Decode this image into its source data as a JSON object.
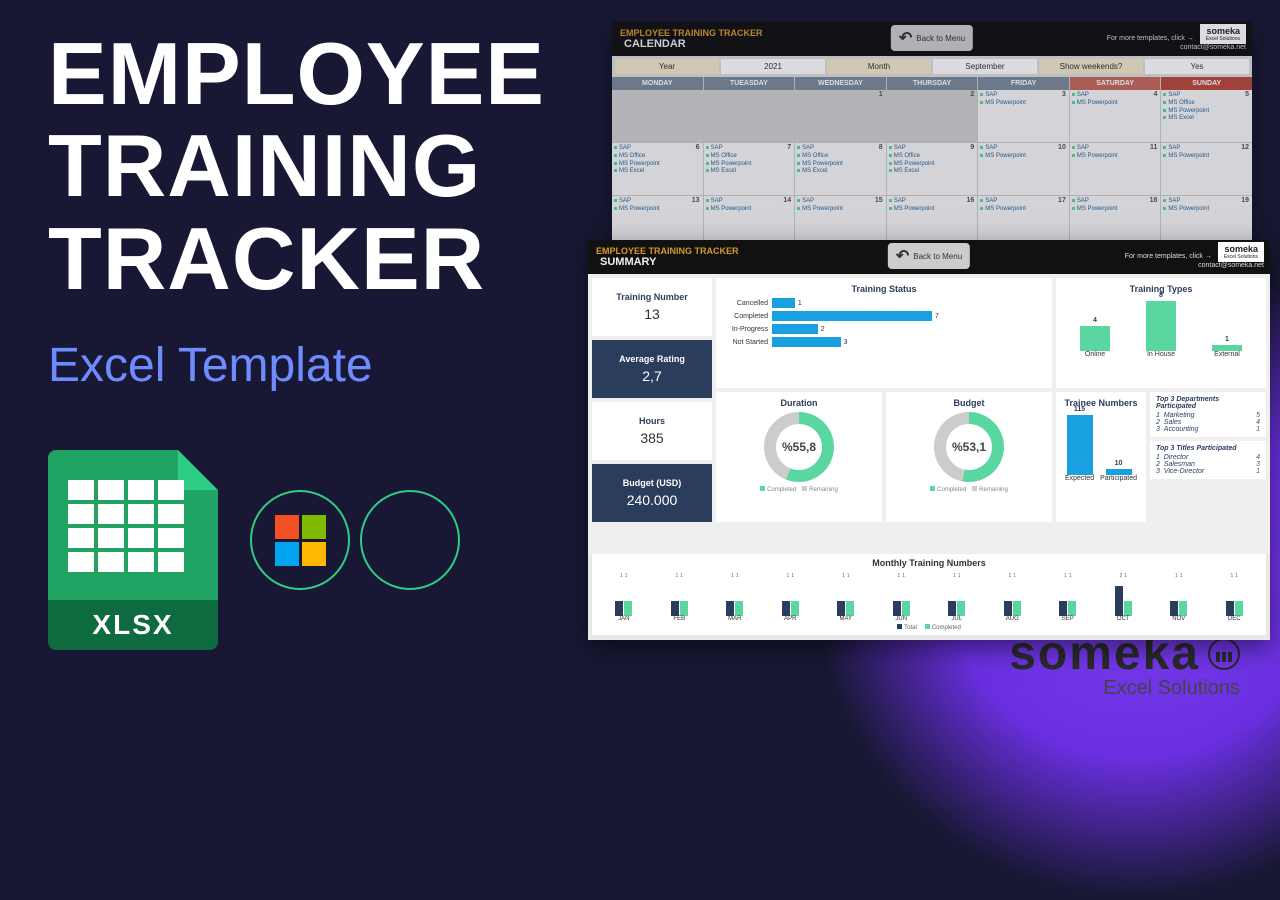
{
  "hero": {
    "line1": "EMPLOYEE",
    "line2": "TRAINING",
    "line3": "TRACKER",
    "subtitle": "Excel Template",
    "xlsx": "XLSX"
  },
  "brand": {
    "name": "someka",
    "sub": "Excel Solutions"
  },
  "header": {
    "product": "EMPLOYEE TRAINING TRACKER",
    "back": "Back to Menu",
    "more": "For more templates, click →",
    "contact": "contact@someka.net",
    "tag": "someka",
    "tag_sub": "Excel Solutions"
  },
  "calendar": {
    "section": "CALENDAR",
    "year_lbl": "Year",
    "year": "2021",
    "month_lbl": "Month",
    "month": "September",
    "wknd_lbl": "Show weekends?",
    "wknd": "Yes",
    "dow": [
      "MONDAY",
      "TUEASDAY",
      "WEDNESDAY",
      "THURSDAY",
      "FRIDAY",
      "SATURDAY",
      "SUNDAY"
    ],
    "cells": [
      {
        "n": "",
        "grey": true
      },
      {
        "n": "",
        "grey": true
      },
      {
        "n": "1",
        "grey": true
      },
      {
        "n": "2",
        "grey": true
      },
      {
        "n": "3",
        "items": [
          "SAP",
          "MS Powerpoint"
        ]
      },
      {
        "n": "4",
        "items": [
          "SAP",
          "MS Powerpoint"
        ]
      },
      {
        "n": "5",
        "items": [
          "SAP",
          "MS Office",
          "MS Powerpoint",
          "MS Excel"
        ]
      },
      {
        "n": "6",
        "items": [
          "SAP",
          "MS Office",
          "MS Powerpoint",
          "MS Excel"
        ]
      },
      {
        "n": "7",
        "items": [
          "SAP",
          "MS Office",
          "MS Powerpoint",
          "MS Excel"
        ]
      },
      {
        "n": "8",
        "items": [
          "SAP",
          "MS Office",
          "MS Powerpoint",
          "MS Excel"
        ]
      },
      {
        "n": "9",
        "items": [
          "SAP",
          "MS Office",
          "MS Powerpoint",
          "MS Excel"
        ]
      },
      {
        "n": "10",
        "items": [
          "SAP",
          "MS Powerpoint"
        ]
      },
      {
        "n": "11",
        "items": [
          "SAP",
          "MS Powerpoint"
        ]
      },
      {
        "n": "12",
        "items": [
          "SAP",
          "MS Powerpoint"
        ]
      },
      {
        "n": "13",
        "items": [
          "SAP",
          "MS Powerpoint"
        ]
      },
      {
        "n": "14",
        "items": [
          "SAP",
          "MS Powerpoint"
        ]
      },
      {
        "n": "15",
        "items": [
          "SAP",
          "MS Powerpoint"
        ]
      },
      {
        "n": "16",
        "items": [
          "SAP",
          "MS Powerpoint"
        ]
      },
      {
        "n": "17",
        "items": [
          "SAP",
          "MS Powerpoint"
        ]
      },
      {
        "n": "18",
        "items": [
          "SAP",
          "MS Powerpoint"
        ]
      },
      {
        "n": "19",
        "items": [
          "SAP",
          "MS Powerpoint"
        ]
      }
    ]
  },
  "summary": {
    "section": "SUMMARY",
    "kpi": {
      "tn_lbl": "Training Number",
      "tn": "13",
      "ar_lbl": "Average Rating",
      "ar": "2,7",
      "hr_lbl": "Hours",
      "hr": "385",
      "bd_lbl": "Budget (USD)",
      "bd": "240.000"
    },
    "status": {
      "title": "Training Status",
      "rows": [
        {
          "lbl": "Cancelled",
          "v": 1
        },
        {
          "lbl": "Completed",
          "v": 7
        },
        {
          "lbl": "In-Progress",
          "v": 2
        },
        {
          "lbl": "Not Started",
          "v": 3
        }
      ]
    },
    "types": {
      "title": "Training Types",
      "bars": [
        {
          "lbl": "Online",
          "v": 4
        },
        {
          "lbl": "In House",
          "v": 8
        },
        {
          "lbl": "External",
          "v": 1
        }
      ]
    },
    "duration": {
      "title": "Duration",
      "pct": "%55,8"
    },
    "budget": {
      "title": "Budget",
      "pct": "%53,1"
    },
    "donut_legend": {
      "a": "Completed",
      "b": "Remaining"
    },
    "trainee": {
      "title": "Trainee Numbers",
      "bars": [
        {
          "lbl": "Expected",
          "v": 115
        },
        {
          "lbl": "Participated",
          "v": 10
        }
      ]
    },
    "top_dept": {
      "title": "Top 3 Departments Participated",
      "rows": [
        {
          "rank": "1",
          "name": "Marketing",
          "v": "5"
        },
        {
          "rank": "2",
          "name": "Sales",
          "v": "4"
        },
        {
          "rank": "3",
          "name": "Accounting",
          "v": "1"
        }
      ]
    },
    "top_titles": {
      "title": "Top 3 Titles Participated",
      "rows": [
        {
          "rank": "1",
          "name": "Director",
          "v": "4"
        },
        {
          "rank": "2",
          "name": "Salesman",
          "v": "3"
        },
        {
          "rank": "3",
          "name": "Vice-Director",
          "v": "1"
        }
      ]
    },
    "monthly": {
      "title": "Monthly Training Numbers",
      "legend": {
        "t": "Total",
        "c": "Completed"
      },
      "months": [
        "JAN",
        "FEB",
        "MAR",
        "APR",
        "MAY",
        "JUN",
        "JUL",
        "AUG",
        "SEP",
        "OCT",
        "NOV",
        "DEC"
      ],
      "total": [
        1,
        1,
        1,
        1,
        1,
        1,
        1,
        1,
        1,
        2,
        1,
        1
      ],
      "completed": [
        1,
        1,
        1,
        1,
        1,
        1,
        1,
        1,
        1,
        1,
        1,
        1
      ]
    }
  },
  "chart_data": [
    {
      "type": "bar",
      "title": "Training Status",
      "orientation": "horizontal",
      "categories": [
        "Cancelled",
        "Completed",
        "In-Progress",
        "Not Started"
      ],
      "values": [
        1,
        7,
        2,
        3
      ]
    },
    {
      "type": "bar",
      "title": "Training Types",
      "categories": [
        "Online",
        "In House",
        "External"
      ],
      "values": [
        4,
        8,
        1
      ]
    },
    {
      "type": "pie",
      "title": "Duration",
      "series": [
        {
          "name": "Completed",
          "values": [
            55.8
          ]
        },
        {
          "name": "Remaining",
          "values": [
            44.2
          ]
        }
      ]
    },
    {
      "type": "pie",
      "title": "Budget",
      "series": [
        {
          "name": "Completed",
          "values": [
            53.1
          ]
        },
        {
          "name": "Remaining",
          "values": [
            46.9
          ]
        }
      ]
    },
    {
      "type": "bar",
      "title": "Trainee Numbers",
      "categories": [
        "Expected",
        "Participated"
      ],
      "values": [
        115,
        10
      ]
    },
    {
      "type": "bar",
      "title": "Monthly Training Numbers",
      "categories": [
        "JAN",
        "FEB",
        "MAR",
        "APR",
        "MAY",
        "JUN",
        "JUL",
        "AUG",
        "SEP",
        "OCT",
        "NOV",
        "DEC"
      ],
      "series": [
        {
          "name": "Total",
          "values": [
            1,
            1,
            1,
            1,
            1,
            1,
            1,
            1,
            1,
            2,
            1,
            1
          ]
        },
        {
          "name": "Completed",
          "values": [
            1,
            1,
            1,
            1,
            1,
            1,
            1,
            1,
            1,
            1,
            1,
            1
          ]
        }
      ],
      "ylim": [
        0,
        2
      ]
    }
  ]
}
